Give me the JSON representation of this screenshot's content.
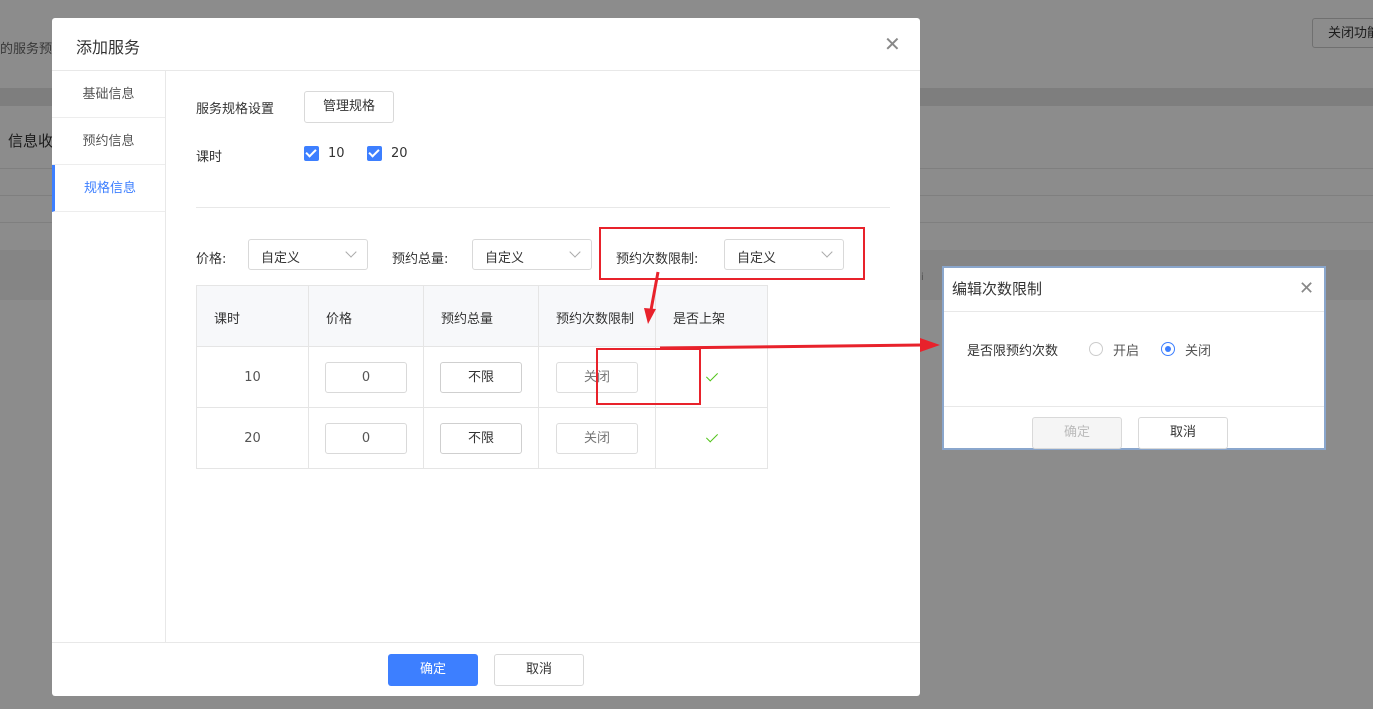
{
  "background": {
    "left_text": "的服务预",
    "close_function_button": "关闭功能",
    "info_label": "信息收",
    "small_label": "i"
  },
  "modal": {
    "title": "添加服务",
    "close_icon": "close-icon",
    "sidebar": {
      "items": [
        {
          "label": "基础信息",
          "active": false
        },
        {
          "label": "预约信息",
          "active": false
        },
        {
          "label": "规格信息",
          "active": true
        }
      ]
    },
    "spec_settings": {
      "label": "服务规格设置",
      "manage_button": "管理规格"
    },
    "lesson": {
      "label": "课时",
      "options": [
        {
          "label": "10",
          "checked": true
        },
        {
          "label": "20",
          "checked": true
        }
      ]
    },
    "filters": {
      "price": {
        "label": "价格:",
        "value": "自定义"
      },
      "total": {
        "label": "预约总量:",
        "value": "自定义"
      },
      "limit": {
        "label": "预约次数限制:",
        "value": "自定义"
      }
    },
    "table": {
      "headers": [
        "课时",
        "价格",
        "预约总量",
        "预约次数限制",
        "是否上架"
      ],
      "rows": [
        {
          "lesson": "10",
          "price": "0",
          "total": "不限",
          "limit": "关闭",
          "listed": true
        },
        {
          "lesson": "20",
          "price": "0",
          "total": "不限",
          "limit": "关闭",
          "listed": true
        }
      ]
    },
    "footer": {
      "confirm": "确定",
      "cancel": "取消"
    }
  },
  "sub_dialog": {
    "title": "编辑次数限制",
    "close_icon": "close-icon",
    "question": "是否限预约次数",
    "options": [
      {
        "label": "开启",
        "selected": false
      },
      {
        "label": "关闭",
        "selected": true
      }
    ],
    "confirm": "确定",
    "cancel": "取消"
  },
  "colors": {
    "accent": "#3d7fff",
    "annotation_red": "#e8222b",
    "check_green": "#52c41a"
  }
}
